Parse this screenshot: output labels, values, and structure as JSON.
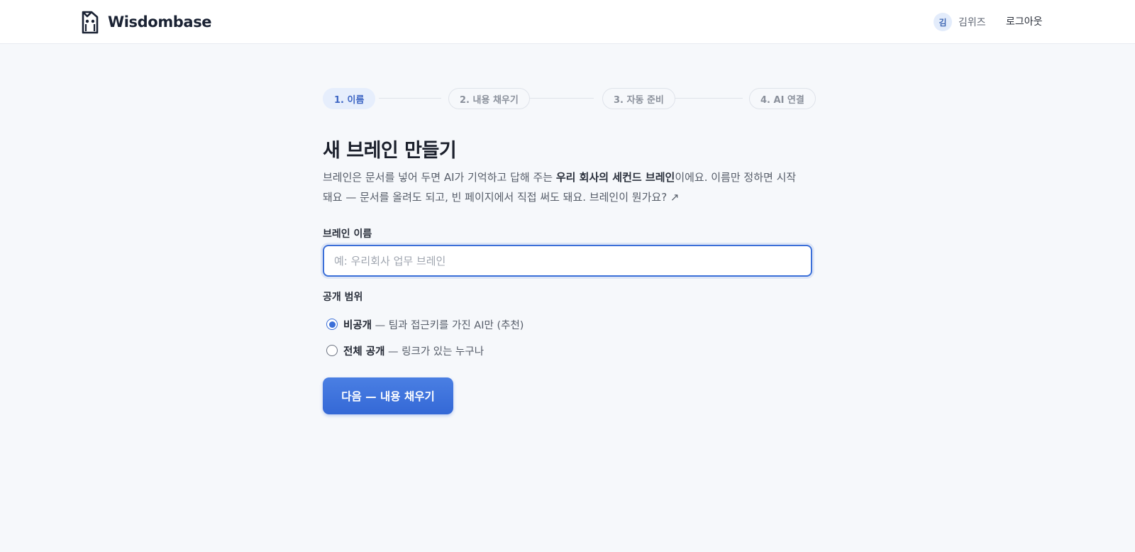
{
  "header": {
    "brand_name": "Wisdombase",
    "user": {
      "avatar_initial": "김",
      "name": "김위즈"
    },
    "logout_label": "로그아웃"
  },
  "stepper": {
    "steps": [
      {
        "label": "1. 이름",
        "active": true
      },
      {
        "label": "2. 내용 채우기",
        "active": false
      },
      {
        "label": "3. 자동 준비",
        "active": false
      },
      {
        "label": "4. AI 연결",
        "active": false
      }
    ]
  },
  "main": {
    "title": "새 브레인 만들기",
    "description": {
      "part1": "브레인은 문서를 넣어 두면 AI가 기억하고 답해 주는 ",
      "bold": "우리 회사의 세컨드 브레인",
      "part2": "이에요. 이름만 정하면 시작돼요 — 문서를 올려도 되고, 빈 페이지에서 직접 써도 돼요. ",
      "link": "브레인이 뭔가요? ↗"
    },
    "name_field": {
      "label": "브레인 이름",
      "value": "",
      "placeholder": "예: 우리회사 업무 브레인"
    },
    "visibility": {
      "label": "공개 범위",
      "options": [
        {
          "title": "비공개",
          "detail": " — 팀과 접근키를 가진 AI만 (추천)",
          "checked": true
        },
        {
          "title": "전체 공개",
          "detail": " — 링크가 있는 누구나",
          "checked": false
        }
      ]
    },
    "next_button": "다음 — 내용 채우기"
  },
  "colors": {
    "accent": "#3b6fd8",
    "background": "#f6f8fb",
    "active_step_bg": "#e6eefc"
  }
}
